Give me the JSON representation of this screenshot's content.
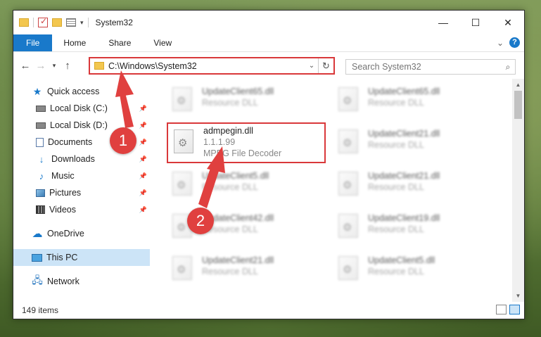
{
  "window": {
    "title": "System32"
  },
  "ribbon": {
    "tabs": [
      "File",
      "Home",
      "Share",
      "View"
    ]
  },
  "address": {
    "path": "C:\\Windows\\System32"
  },
  "search": {
    "placeholder": "Search System32"
  },
  "sidebar": {
    "items": [
      {
        "label": "Quick access",
        "icon": "star-icon"
      },
      {
        "label": "Local Disk (C:)",
        "icon": "drive-icon",
        "pinned": true
      },
      {
        "label": "Local Disk (D:)",
        "icon": "drive-icon",
        "pinned": true
      },
      {
        "label": "Documents",
        "icon": "documents-icon",
        "pinned": true
      },
      {
        "label": "Downloads",
        "icon": "download-icon",
        "pinned": true
      },
      {
        "label": "Music",
        "icon": "music-icon",
        "pinned": true
      },
      {
        "label": "Pictures",
        "icon": "pictures-icon",
        "pinned": true
      },
      {
        "label": "Videos",
        "icon": "videos-icon",
        "pinned": true
      },
      {
        "label": "OneDrive",
        "icon": "cloud-icon"
      },
      {
        "label": "This PC",
        "icon": "pc-icon",
        "selected": true
      },
      {
        "label": "Network",
        "icon": "network-icon"
      }
    ]
  },
  "files": [
    {
      "name": "UpdateClient65.dll",
      "sub": "Resource DLL"
    },
    {
      "name": "UpdateClient65.dll",
      "sub": "Resource DLL"
    },
    {
      "name": "admpegin.dll",
      "version": "1.1.1.99",
      "sub": "MPEG File Decoder",
      "highlighted": true
    },
    {
      "name": "UpdateClient21.dll",
      "sub": "Resource DLL"
    },
    {
      "name": "UpdateClient5.dll",
      "sub": "Resource DLL"
    },
    {
      "name": "UpdateClient21.dll",
      "sub": "Resource DLL"
    },
    {
      "name": "UpdateClient42.dll",
      "sub": "Resource DLL"
    },
    {
      "name": "UpdateClient19.dll",
      "sub": "Resource DLL"
    },
    {
      "name": "UpdateClient21.dll",
      "sub": "Resource DLL"
    },
    {
      "name": "UpdateClient5.dll",
      "sub": "Resource DLL"
    }
  ],
  "status": {
    "count": "149 items"
  },
  "annotations": {
    "step1": "1",
    "step2": "2"
  },
  "colors": {
    "accent": "#1979ca",
    "highlight": "#d9383a"
  }
}
